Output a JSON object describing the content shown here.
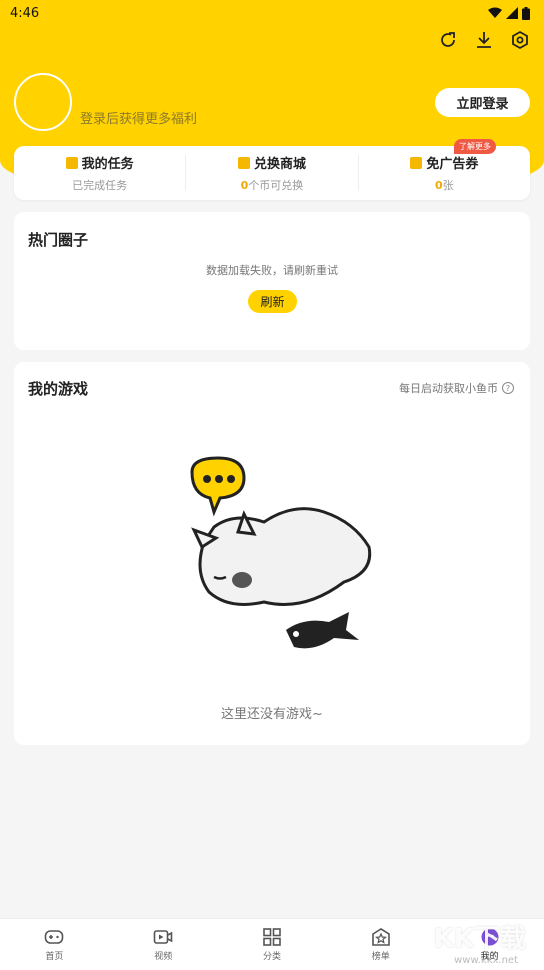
{
  "status_bar": {
    "time": "4:46"
  },
  "profile": {
    "login_hint": "登录后获得更多福利",
    "login_button": "立即登录"
  },
  "quick": {
    "tasks": {
      "title": "我的任务",
      "sub": "已完成任务"
    },
    "shop": {
      "title": "兑换商城",
      "count": "0",
      "sub": "个币可兑换"
    },
    "adfree": {
      "title": "免广告券",
      "badge": "了解更多",
      "count": "0",
      "sub": "张"
    }
  },
  "hot_circle": {
    "title": "热门圈子",
    "message": "数据加载失败，请刷新重试",
    "refresh": "刷新"
  },
  "my_games": {
    "title": "我的游戏",
    "hint": "每日启动获取小鱼币",
    "help": "?",
    "empty": "这里还没有游戏~"
  },
  "nav": [
    {
      "label": "首页",
      "icon": "gamepad-icon"
    },
    {
      "label": "视频",
      "icon": "video-icon"
    },
    {
      "label": "分类",
      "icon": "grid-icon"
    },
    {
      "label": "榜单",
      "icon": "ranking-icon"
    },
    {
      "label": "我的",
      "icon": "profile-icon"
    }
  ],
  "watermark": {
    "text": "KK下载",
    "url": "www.kkx.net"
  },
  "colors": {
    "accent": "#ffd200",
    "badge": "#f05a44",
    "highlight": "#f2a900"
  }
}
